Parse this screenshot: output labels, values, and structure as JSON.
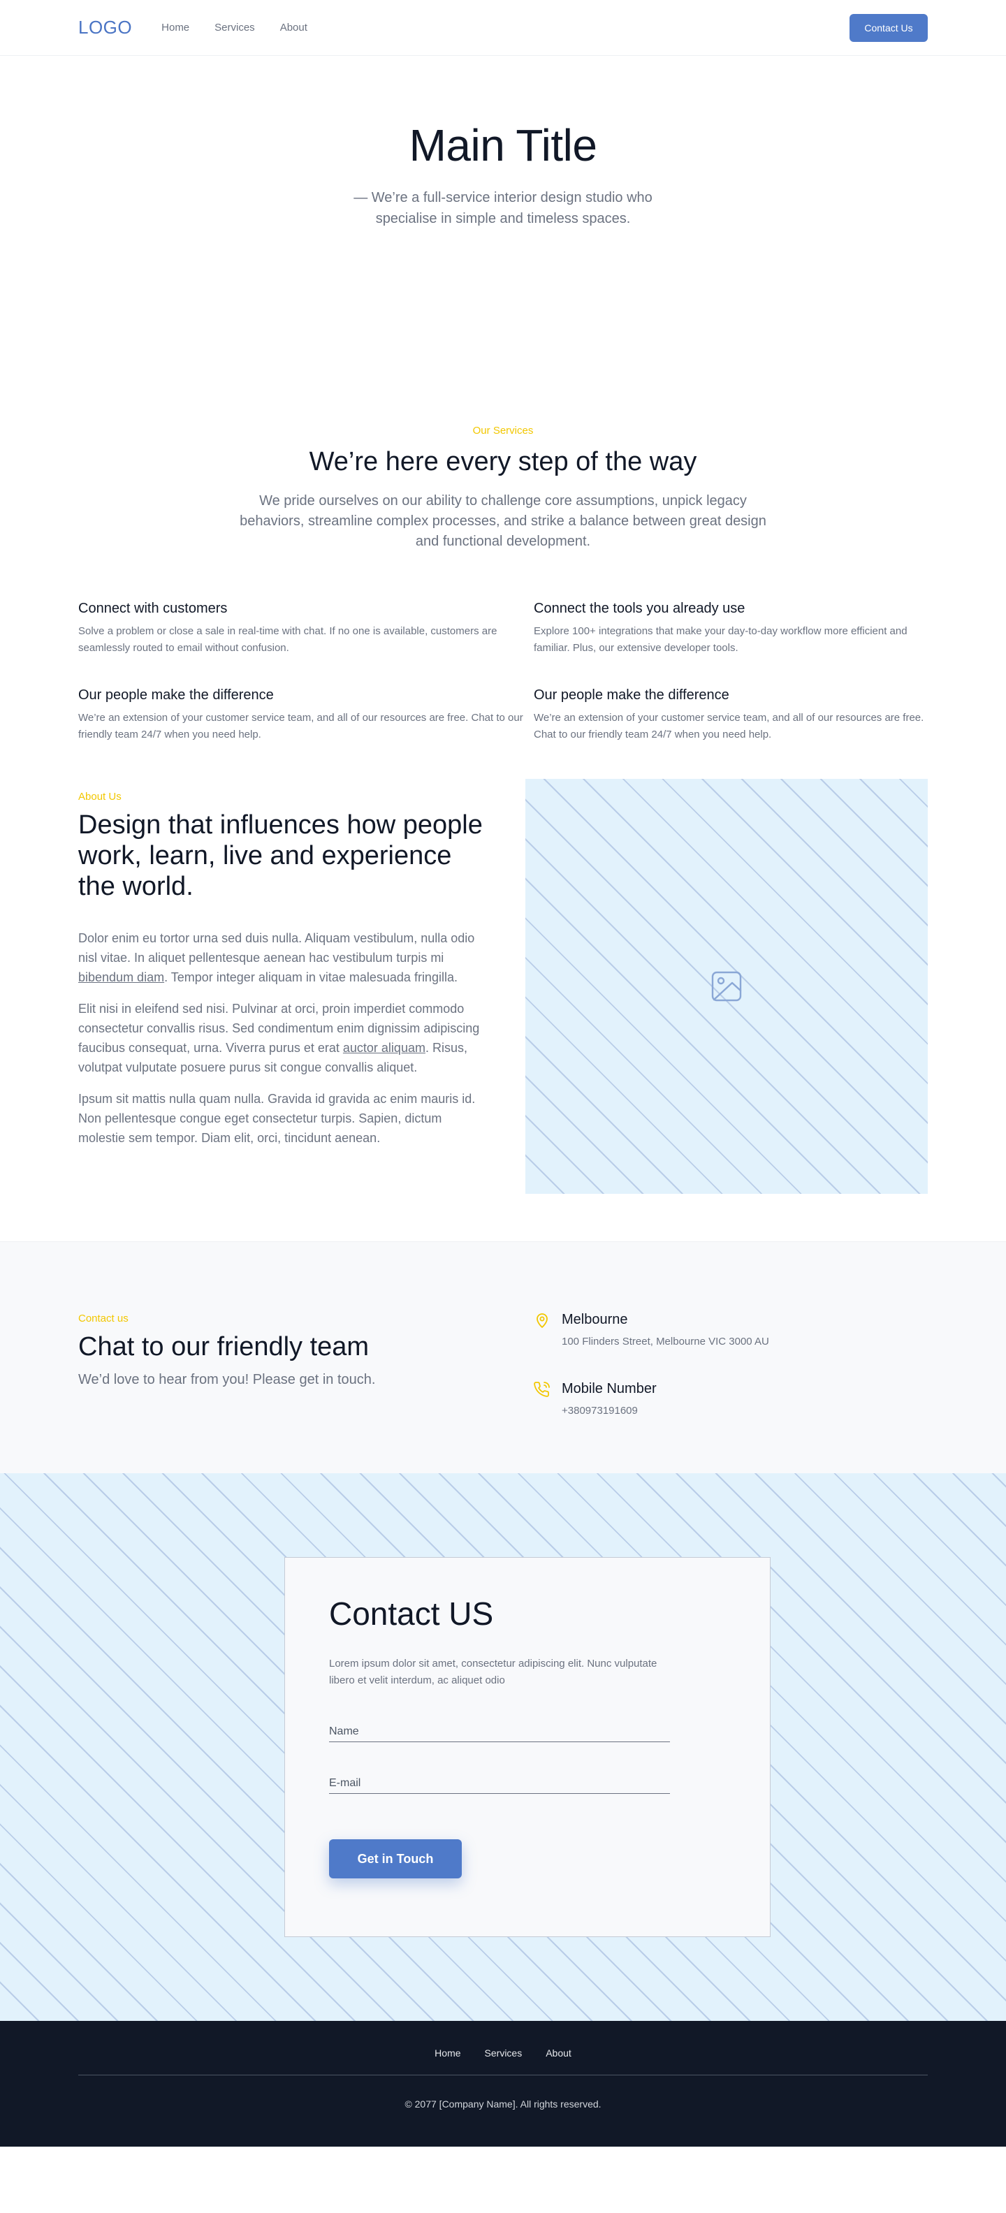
{
  "header": {
    "logo": "LOGO",
    "nav": [
      "Home",
      "Services",
      "About"
    ],
    "cta_label": "Contact Us"
  },
  "hero": {
    "title": "Main Title",
    "subtitle": "— We’re a full-service interior design studio who specialise in simple and timeless spaces."
  },
  "services": {
    "eyebrow": "Our Services",
    "title": "We’re here every step of the way",
    "lead": "We pride ourselves on our ability to challenge core assumptions, unpick legacy behaviors, streamline complex processes, and strike a balance between great design and functional development.",
    "features": [
      {
        "title": "Connect with customers",
        "text": "Solve a problem or close a sale in real-time with chat. If no one is available, customers are seamlessly routed to email without confusion."
      },
      {
        "title": "Connect the tools you already use",
        "text": "Explore 100+ integrations that make your day-to-day workflow more efficient and familiar. Plus, our extensive developer tools."
      },
      {
        "title": "Our people make the difference",
        "text": "We’re an extension of your customer service team, and all of our resources are free. Chat to our friendly team 24/7 when you need help."
      },
      {
        "title": "Our people make the difference",
        "text": "We’re an extension of your customer service team, and all of our resources are free. Chat to our friendly team 24/7 when you need help."
      }
    ]
  },
  "about": {
    "eyebrow": "About Us",
    "title": "Design that influences how people work, learn, live and experience the world.",
    "p1_before": "Dolor enim eu tortor urna sed duis nulla. Aliquam vestibulum, nulla odio nisl vitae. In aliquet pellentesque aenean hac vestibulum turpis mi ",
    "p1_link": "bibendum diam",
    "p1_after": ". Tempor integer aliquam in vitae malesuada fringilla.",
    "p2_before": "Elit nisi in eleifend sed nisi. Pulvinar at orci, proin imperdiet commodo consectetur convallis risus. Sed condimentum enim dignissim adipiscing faucibus consequat, urna. Viverra purus et erat ",
    "p2_link": "auctor aliquam",
    "p2_after": ". Risus, volutpat vulputate posuere purus sit congue convallis aliquet.",
    "p3": "Ipsum sit mattis nulla quam nulla. Gravida id gravida ac enim mauris id. Non pellentesque congue eget consectetur turpis. Sapien, dictum molestie sem tempor. Diam elit, orci, tincidunt aenean.",
    "image_icon": "image-icon"
  },
  "contact_info": {
    "eyebrow": "Contact us",
    "title": "Chat to our friendly team",
    "subtitle": "We’d love to hear from you! Please get in touch.",
    "items": [
      {
        "icon": "location-pin-icon",
        "title": "Melbourne",
        "text": "100 Flinders Street, Melbourne VIC 3000 AU"
      },
      {
        "icon": "phone-icon",
        "title": "Mobile Number",
        "text": "+380973191609"
      }
    ]
  },
  "contact_form": {
    "title": "Contact US",
    "description": "Lorem ipsum dolor sit amet, consectetur adipiscing elit. Nunc vulputate libero et velit interdum, ac aliquet odio",
    "name_placeholder": "Name",
    "email_placeholder": "E-mail",
    "submit_label": "Get in Touch"
  },
  "footer": {
    "nav": [
      "Home",
      "Services",
      "About"
    ],
    "copyright": "© 2077 [Company Name]. All rights reserved."
  },
  "colors": {
    "brand": "#4f7ac9",
    "accent": "#f2c700",
    "dark": "#111827",
    "muted": "#6b7280",
    "pattern_bg": "#e2f2fc"
  }
}
